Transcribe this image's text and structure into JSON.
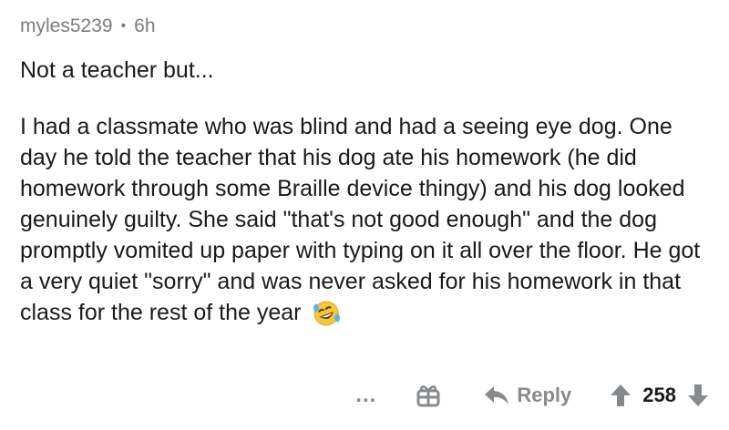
{
  "comment": {
    "username": "myles5239",
    "separator": "•",
    "age": "6h",
    "first_line": "Not a teacher but...",
    "paragraph": "I had a classmate who was blind and had a seeing eye dog. One day he told the teacher that his dog ate his homework (he did homework through some Braille device thingy) and his dog looked genuinely guilty. She said \"that's not good enough\" and the dog promptly vomited up paper with typing on it all over the floor. He got a very quiet \"sorry\" and was never asked for his homework in that class for the rest of the year",
    "emoji_icon": "rolling-on-floor-laughing-emoji"
  },
  "actions": {
    "more_label": "...",
    "award_icon": "gift-icon",
    "reply_label": "Reply",
    "upvote_icon": "up-arrow-icon",
    "score": "258",
    "downvote_icon": "down-arrow-icon"
  },
  "colors": {
    "meta_gray": "#7c7c7c",
    "action_gray": "#878a8c",
    "text": "#1a1a1b",
    "emoji_yellow": "#f7c53b"
  }
}
